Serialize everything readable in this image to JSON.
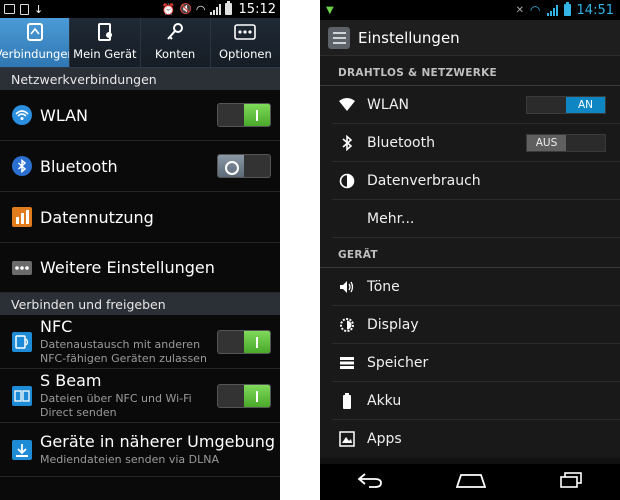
{
  "left": {
    "status_bar": {
      "time": "15:12"
    },
    "tabs": [
      {
        "label": "Verbindungen",
        "icon": "connections-icon",
        "active": true
      },
      {
        "label": "Mein Gerät",
        "icon": "device-icon",
        "active": false
      },
      {
        "label": "Konten",
        "icon": "key-icon",
        "active": false
      },
      {
        "label": "Optionen",
        "icon": "more-options-icon",
        "active": false
      }
    ],
    "section_network": "Netzwerkverbindungen",
    "section_connect": "Verbinden und freigeben",
    "items": {
      "wlan": {
        "title": "WLAN",
        "switch": "on"
      },
      "bluetooth": {
        "title": "Bluetooth",
        "switch": "off"
      },
      "data": {
        "title": "Datennutzung"
      },
      "more": {
        "title": "Weitere Einstellungen"
      },
      "nfc": {
        "title": "NFC",
        "subtitle": "Datenaustausch mit anderen NFC-fähigen Geräten zulassen",
        "switch": "on"
      },
      "sbeam": {
        "title": "S Beam",
        "subtitle": "Dateien über NFC und Wi-Fi Direct senden",
        "switch": "on"
      },
      "nearby": {
        "title": "Geräte in näherer Umgebung",
        "subtitle": "Mediendateien senden via DLNA"
      }
    },
    "colors": {
      "accent": "#3a86c6",
      "switch_on": "#5cc13a"
    }
  },
  "right": {
    "status_bar": {
      "time": "14:51"
    },
    "title": "Einstellungen",
    "section_wireless": "DRAHTLOS & NETZWERKE",
    "section_device": "GERÄT",
    "items": {
      "wlan": {
        "title": "WLAN",
        "toggle_label": "AN"
      },
      "bluetooth": {
        "title": "Bluetooth",
        "toggle_label": "AUS"
      },
      "data_usage": {
        "title": "Datenverbrauch"
      },
      "more": {
        "title": "Mehr..."
      },
      "sounds": {
        "title": "Töne"
      },
      "display": {
        "title": "Display"
      },
      "storage": {
        "title": "Speicher"
      },
      "battery": {
        "title": "Akku"
      },
      "apps": {
        "title": "Apps"
      }
    },
    "colors": {
      "accent": "#33b5e5",
      "toggle_on": "#0e86c4"
    }
  }
}
